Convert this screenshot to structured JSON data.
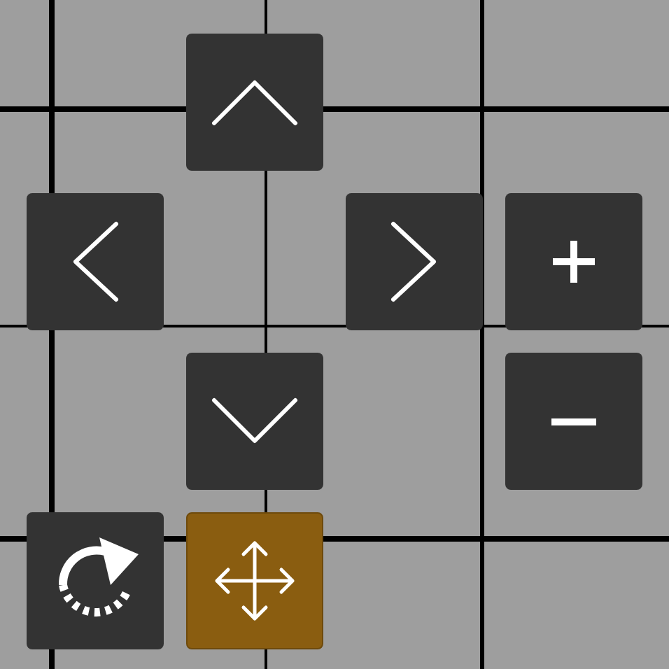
{
  "controls": [
    {
      "kind": "up",
      "selected": false
    },
    {
      "kind": "left",
      "selected": false
    },
    {
      "kind": "right",
      "selected": false
    },
    {
      "kind": "zoom_in",
      "selected": false
    },
    {
      "kind": "down",
      "selected": false
    },
    {
      "kind": "zoom_out",
      "selected": false
    },
    {
      "kind": "rotate",
      "selected": false
    },
    {
      "kind": "move",
      "selected": true
    }
  ]
}
